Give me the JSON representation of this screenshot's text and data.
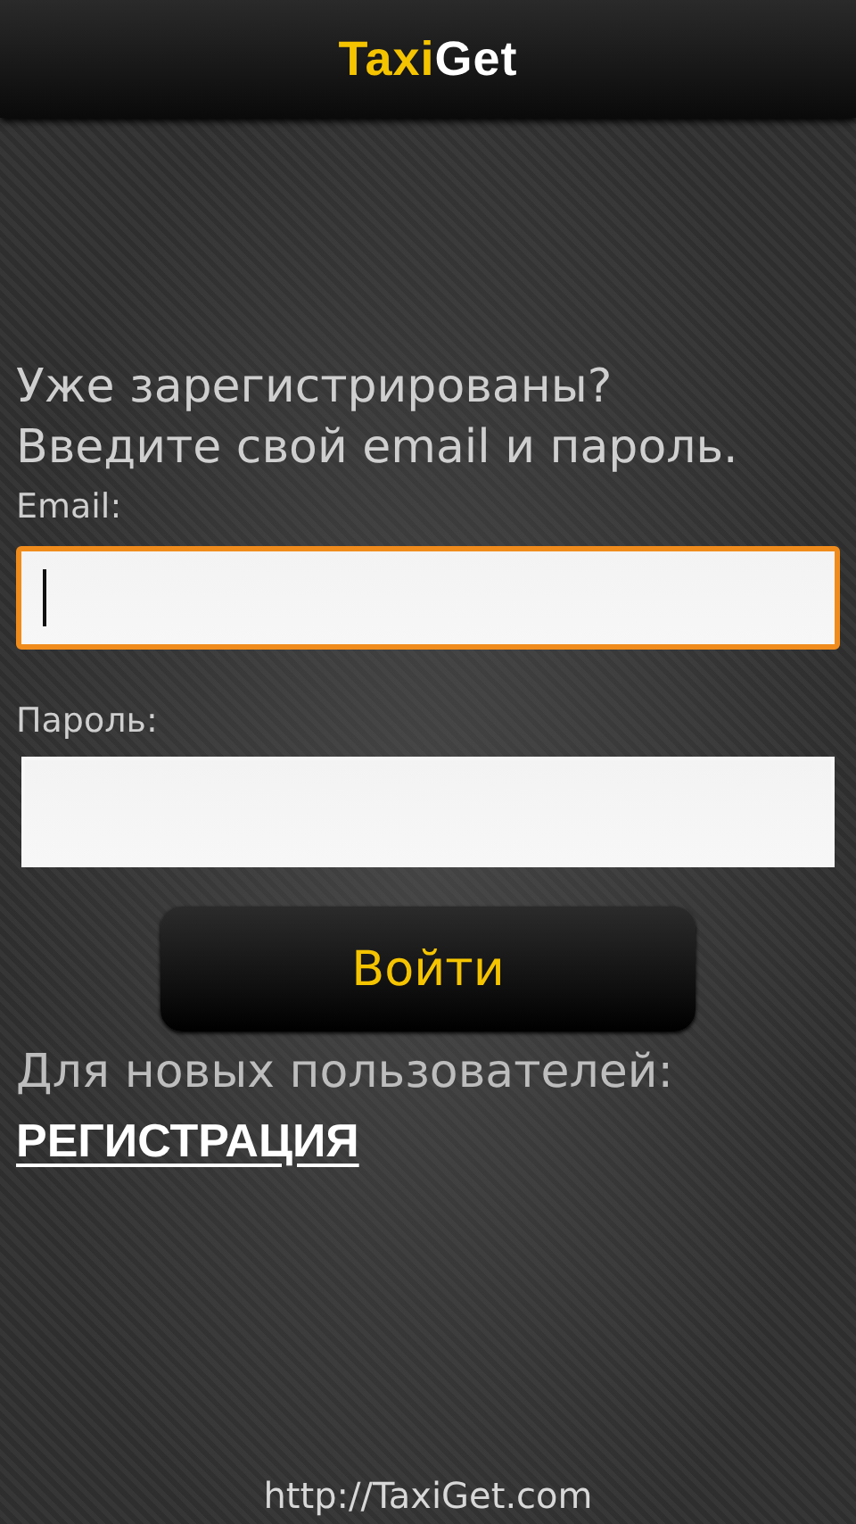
{
  "header": {
    "title_parts": [
      {
        "text": "Taxi",
        "color": "#f5c400"
      },
      {
        "text": "Get",
        "color": "#ffffff"
      }
    ]
  },
  "intro": [
    "Уже зарегистрированы?",
    "Введите свой email и пароль."
  ],
  "fields": [
    {
      "label": "Email:",
      "focused": true
    },
    {
      "label": "Пароль:",
      "focused": false
    }
  ],
  "login_button": "Войти",
  "new_users_text": "Для новых пользователей:",
  "register_link": "РЕГИСТРАЦИЯ",
  "footer_link": "http://TaxiGet.com"
}
